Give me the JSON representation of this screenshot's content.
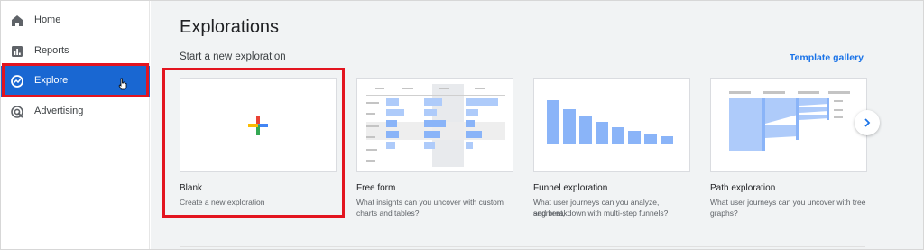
{
  "sidebar": {
    "items": [
      {
        "label": "Home",
        "icon": "home-icon"
      },
      {
        "label": "Reports",
        "icon": "reports-icon"
      },
      {
        "label": "Explore",
        "icon": "explore-icon",
        "active": true
      },
      {
        "label": "Advertising",
        "icon": "advertising-icon"
      }
    ]
  },
  "main": {
    "title": "Explorations",
    "section_title": "Start a new exploration",
    "template_link": "Template gallery",
    "cards": [
      {
        "title": "Blank",
        "desc": "Create a new exploration"
      },
      {
        "title": "Free form",
        "desc_line1": "What insights can you uncover with custom",
        "desc_line2": "charts and tables?"
      },
      {
        "title": "Funnel exploration",
        "desc_line1": "What user journeys can you analyze, segment,",
        "desc_line2": "and breakdown with multi-step funnels?"
      },
      {
        "title": "Path exploration",
        "desc_line1": "What user journeys can you uncover with tree",
        "desc_line2": "graphs?"
      }
    ],
    "next_icon": "chevron-right-icon"
  },
  "colors": {
    "active_nav": "#1967d2",
    "highlight": "#e3141f",
    "link": "#1a73e8",
    "chart_bar": "#8ab4f8"
  }
}
